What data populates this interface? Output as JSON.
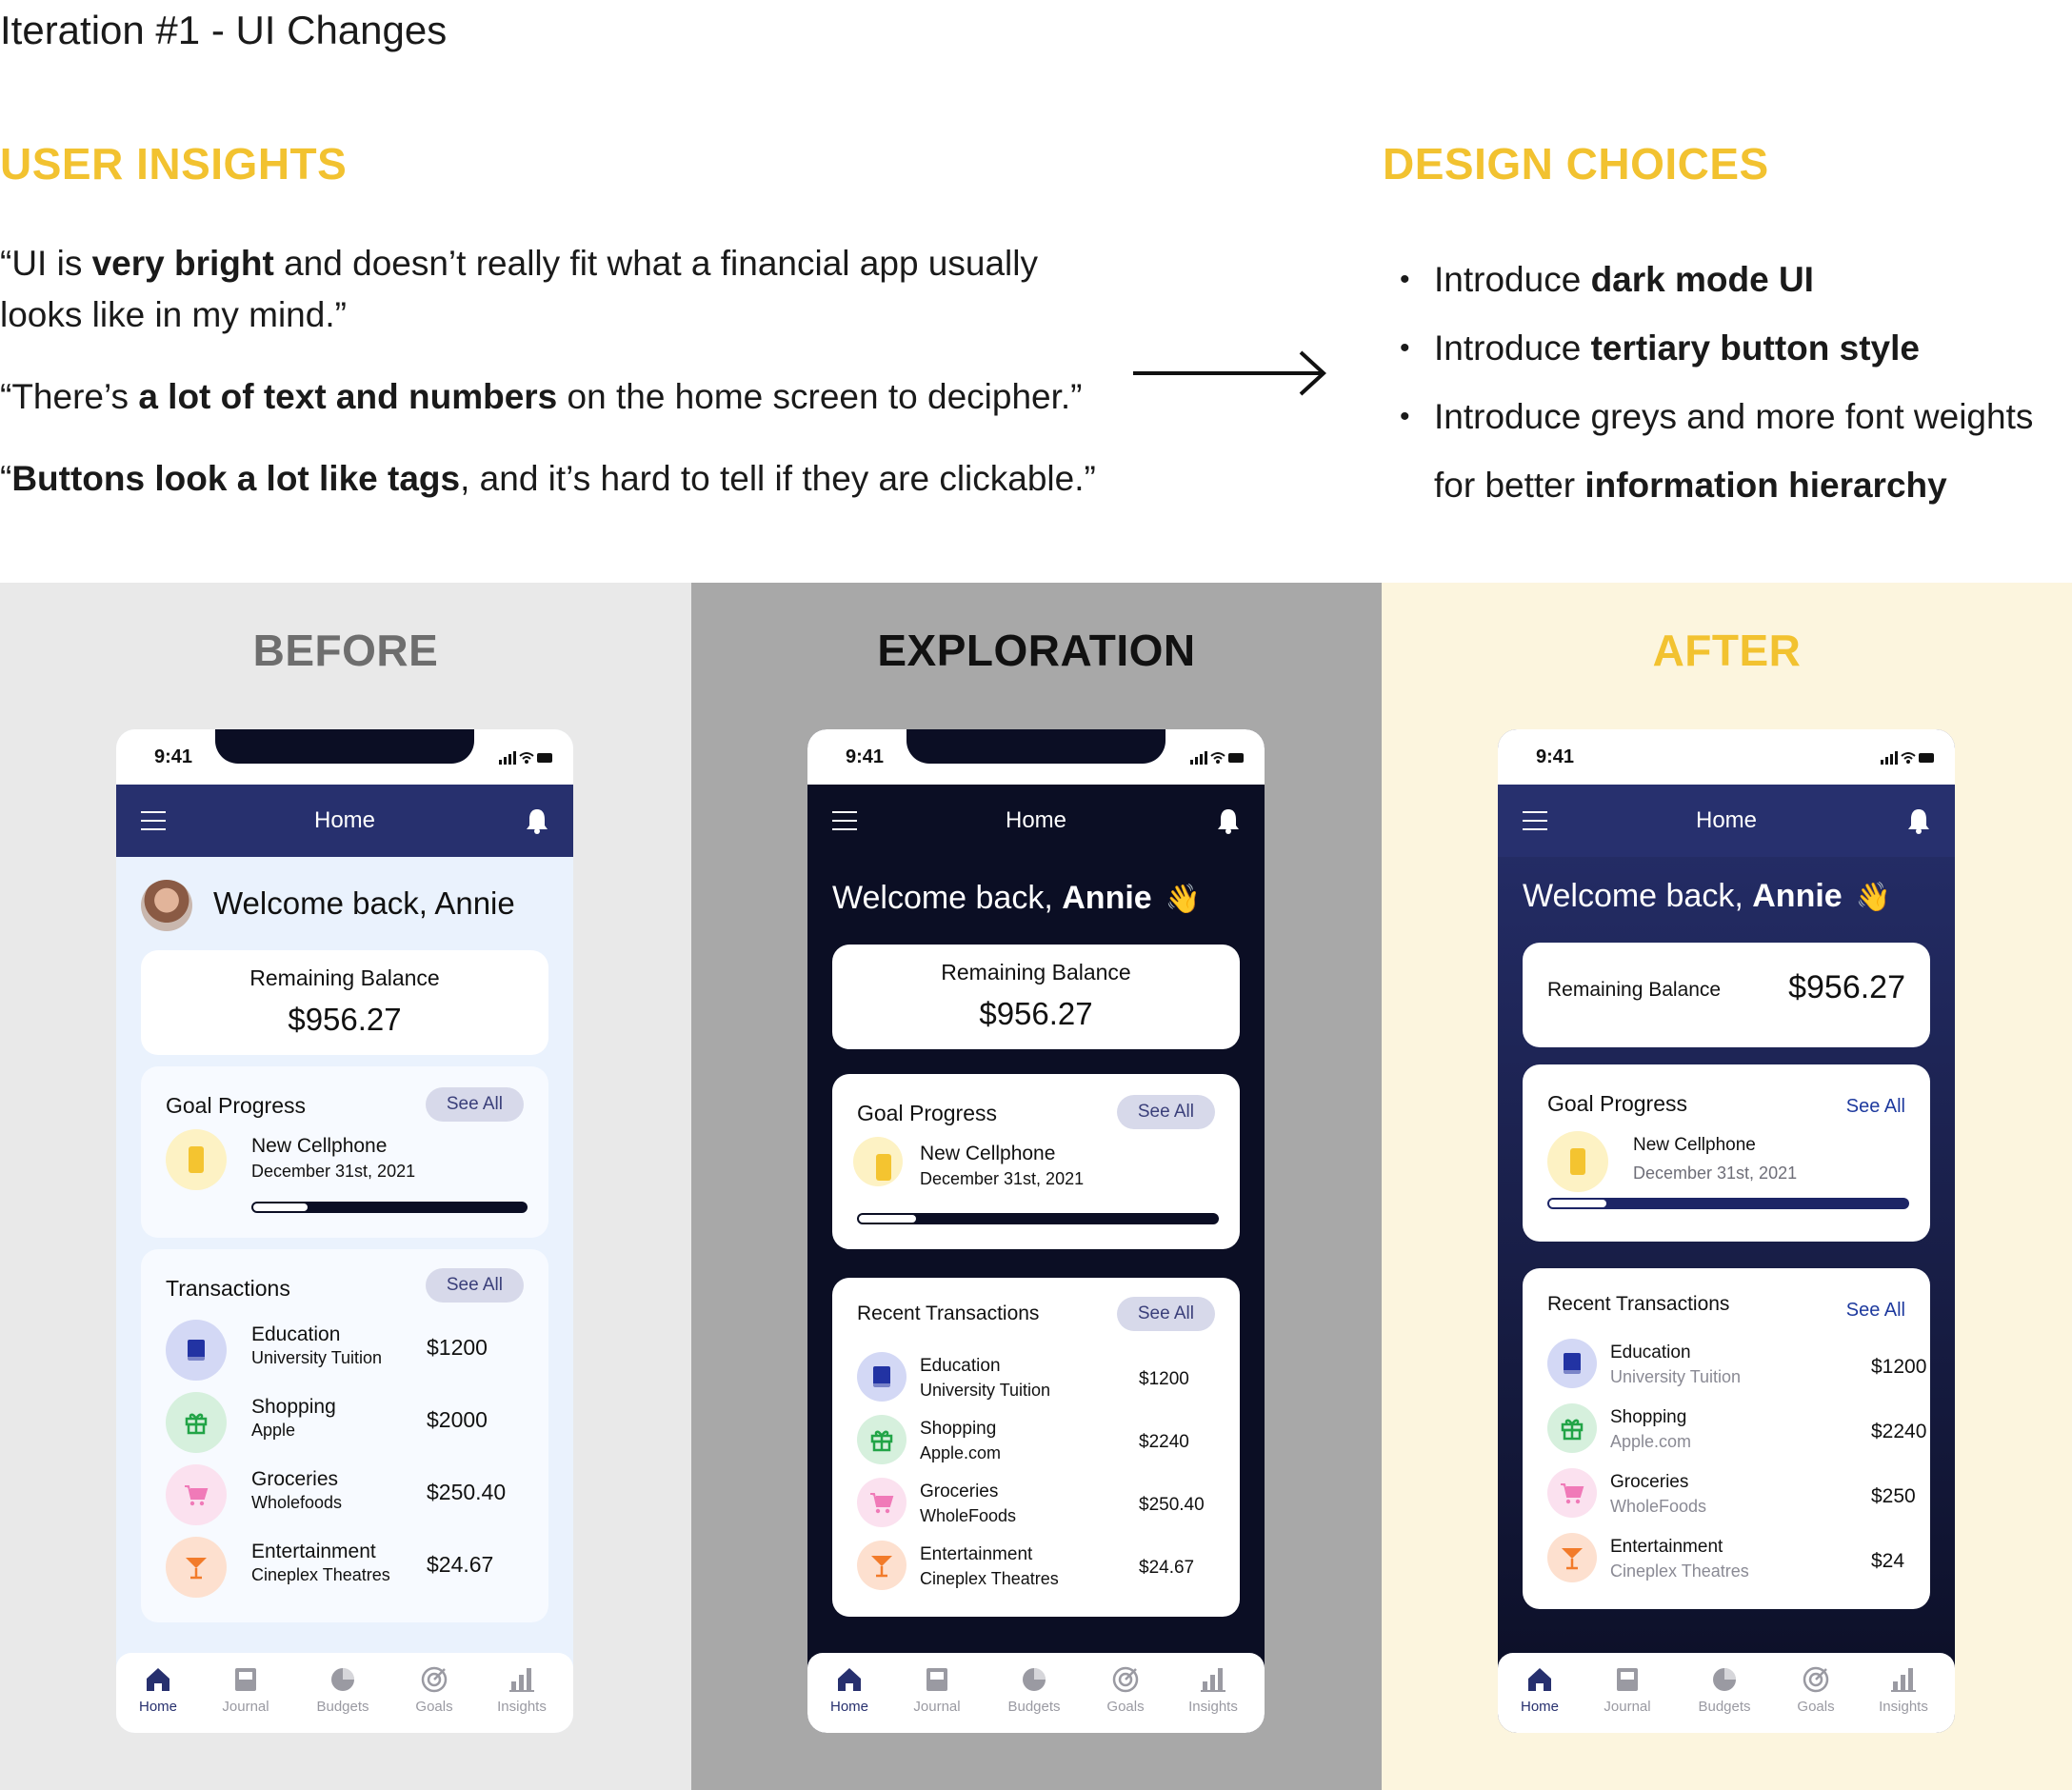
{
  "page_title": "Iteration #1 - UI Changes",
  "user_insights": {
    "heading": "USER INSIGHTS",
    "quotes": [
      {
        "parts": [
          {
            "t": "“UI is ",
            "b": false
          },
          {
            "t": "very bright",
            "b": true
          },
          {
            "t": " and doesn’t really fit what a financial app usually looks like in my mind.”",
            "b": false
          }
        ]
      },
      {
        "parts": [
          {
            "t": "“There’s ",
            "b": false
          },
          {
            "t": "a lot of text and numbers",
            "b": true
          },
          {
            "t": " on the home screen to decipher.”",
            "b": false
          }
        ]
      },
      {
        "parts": [
          {
            "t": "“",
            "b": false
          },
          {
            "t": "Buttons look a lot like tags",
            "b": true
          },
          {
            "t": ", and it’s hard to tell if they are clickable.”",
            "b": false
          }
        ]
      }
    ]
  },
  "design_choices": {
    "heading": "DESIGN CHOICES",
    "items": [
      {
        "parts": [
          {
            "t": "Introduce ",
            "b": false
          },
          {
            "t": "dark mode UI",
            "b": true
          }
        ]
      },
      {
        "parts": [
          {
            "t": "Introduce ",
            "b": false
          },
          {
            "t": "tertiary button style",
            "b": true
          }
        ]
      },
      {
        "parts": [
          {
            "t": "Introduce greys and more font weights for better ",
            "b": false
          },
          {
            "t": "information hierarchy",
            "b": true
          }
        ]
      }
    ]
  },
  "colors": {
    "accent_yellow": "#f2c230",
    "before_bg": "#e9e9e9",
    "exploration_bg": "#a8a8a8",
    "after_bg": "#fcf5de",
    "navy": "#27306e",
    "dark": "#0b0e24"
  },
  "icons": {
    "menu": "hamburger-icon",
    "bell": "bell-icon",
    "education": "book-icon",
    "shopping": "gift-icon",
    "groceries": "cart-icon",
    "entertainment": "cocktail-icon",
    "goal": "phone-icon",
    "tabs": [
      "home-icon",
      "journal-icon",
      "budgets-icon",
      "goals-icon",
      "insights-icon"
    ]
  },
  "phones": [
    {
      "panel_title": "BEFORE",
      "time": "9:41",
      "app_title": "Home",
      "welcome_prefix": "Welcome back, ",
      "welcome_name": "Annie",
      "welcome_emoji": "",
      "balance_label": "Remaining Balance",
      "balance_value": "$956.27",
      "goal_title": "Goal Progress",
      "see_all": "See All",
      "goal_name": "New Cellphone",
      "goal_date": "December 31st, 2021",
      "goal_progress": 0.2,
      "tx_title": "Transactions",
      "transactions": [
        {
          "category": "Education",
          "detail": "University Tuition",
          "amount": "$1200"
        },
        {
          "category": "Shopping",
          "detail": "Apple",
          "amount": "$2000"
        },
        {
          "category": "Groceries",
          "detail": "Wholefoods",
          "amount": "$250.40"
        },
        {
          "category": "Entertainment",
          "detail": "Cineplex Theatres",
          "amount": "$24.67"
        }
      ],
      "tabs": [
        "Home",
        "Journal",
        "Budgets",
        "Goals",
        "Insights"
      ],
      "active_tab": "Home"
    },
    {
      "panel_title": "EXPLORATION",
      "time": "9:41",
      "app_title": "Home",
      "welcome_prefix": "Welcome back, ",
      "welcome_name": "Annie",
      "welcome_emoji": "👋",
      "balance_label": "Remaining Balance",
      "balance_value": "$956.27",
      "goal_title": "Goal Progress",
      "see_all": "See All",
      "goal_name": "New Cellphone",
      "goal_date": "December 31st, 2021",
      "goal_progress": 0.16,
      "tx_title": "Recent Transactions",
      "transactions": [
        {
          "category": "Education",
          "detail": "University Tuition",
          "amount": "$1200"
        },
        {
          "category": "Shopping",
          "detail": "Apple.com",
          "amount": "$2240"
        },
        {
          "category": "Groceries",
          "detail": "WholeFoods",
          "amount": "$250.40"
        },
        {
          "category": "Entertainment",
          "detail": "Cineplex Theatres",
          "amount": "$24.67"
        }
      ],
      "tabs": [
        "Home",
        "Journal",
        "Budgets",
        "Goals",
        "Insights"
      ],
      "active_tab": "Home"
    },
    {
      "panel_title": "AFTER",
      "time": "9:41",
      "app_title": "Home",
      "welcome_prefix": "Welcome back, ",
      "welcome_name": "Annie",
      "welcome_emoji": "👋",
      "balance_label": "Remaining Balance",
      "balance_value": "$956.27",
      "goal_title": "Goal Progress",
      "see_all": "See All",
      "goal_name": "New Cellphone",
      "goal_date": "December 31st, 2021",
      "goal_progress": 0.16,
      "tx_title": "Recent Transactions",
      "transactions": [
        {
          "category": "Education",
          "detail": "University Tuition",
          "amount": "$1200"
        },
        {
          "category": "Shopping",
          "detail": "Apple.com",
          "amount": "$2240"
        },
        {
          "category": "Groceries",
          "detail": "WholeFoods",
          "amount": "$250"
        },
        {
          "category": "Entertainment",
          "detail": "Cineplex Theatres",
          "amount": "$24"
        }
      ],
      "tabs": [
        "Home",
        "Journal",
        "Budgets",
        "Goals",
        "Insights"
      ],
      "active_tab": "Home"
    }
  ]
}
